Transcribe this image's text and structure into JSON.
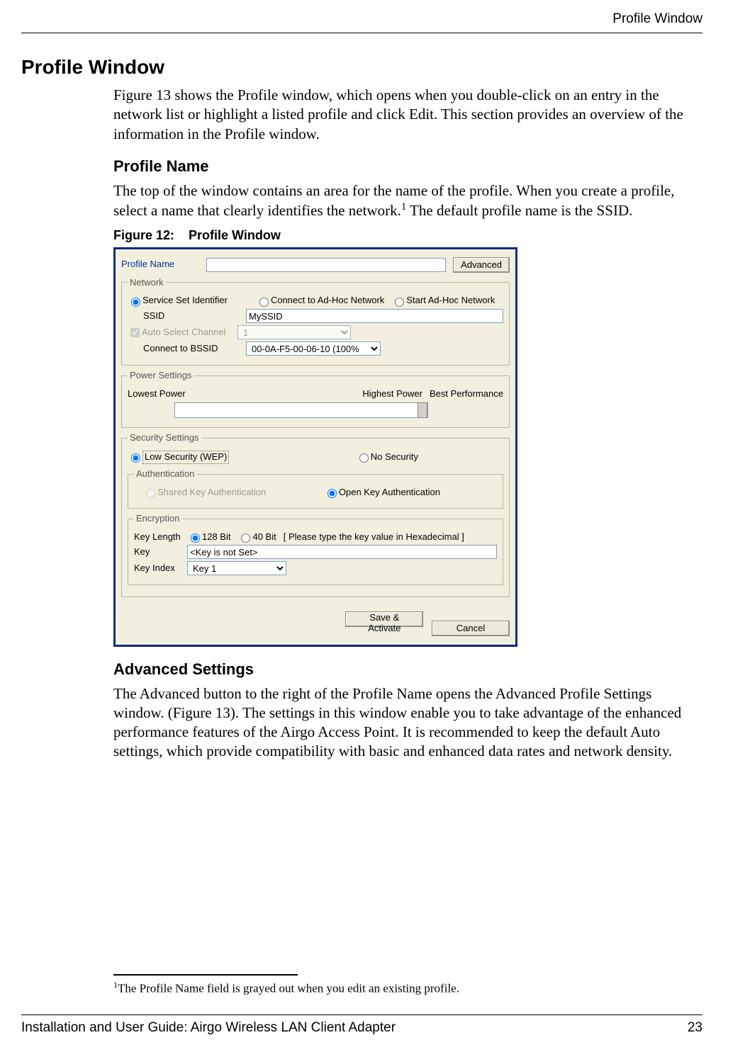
{
  "running_head": "Profile Window",
  "h1": "Profile Window",
  "intro": "Figure 13 shows the Profile window, which opens when you double-click on an entry in the network list or highlight a listed profile and click Edit. This section provides an overview of the information in the Profile window.",
  "profile_name_h": "Profile Name",
  "profile_name_p_a": "The top of the window contains an area for the name of the profile. When you create a profile, select a name that clearly identifies the network.",
  "profile_name_p_b": " The default profile name is the SSID.",
  "sup1": "1",
  "fig_caption_a": "Figure 12:",
  "fig_caption_b": "Profile Window",
  "adv_h": "Advanced Settings",
  "adv_p": "The Advanced button to the right of the Profile Name opens the Advanced Profile Settings window. (Figure 13). The settings in this window enable you to take advantage of the enhanced performance features of the Airgo Access Point. It is recommended to keep the default Auto settings, which provide compatibility with basic and enhanced data rates and network density.",
  "footnote_sup": "1",
  "footnote_text": "The Profile Name field is grayed out when you edit an existing profile.",
  "footer_left": "Installation and User Guide: Airgo Wireless LAN Client Adapter",
  "footer_right": "23",
  "shot": {
    "profile_name_lbl": "Profile Name",
    "profile_name_val": "",
    "advanced_btn": "Advanced",
    "network_legend": "Network",
    "ssi_radio": "Service Set Identifier",
    "adhoc_connect": "Connect to Ad-Hoc Network",
    "adhoc_start": "Start Ad-Hoc Network",
    "ssid_lbl": "SSID",
    "ssid_val": "MySSID",
    "autoch_lbl": "Auto Select Channel",
    "autoch_val": "1",
    "bssid_lbl": "Connect to BSSID",
    "bssid_val": "00-0A-F5-00-06-10 (100%",
    "power_legend": "Power Settings",
    "power_low": "Lowest Power",
    "power_high": "Highest Power",
    "power_best": "Best Performance",
    "sec_legend": "Security Settings",
    "sec_low": "Low Security (WEP)",
    "sec_none": "No Security",
    "auth_legend": "Authentication",
    "auth_shared": "Shared Key Authentication",
    "auth_open": "Open Key Authentication",
    "enc_legend": "Encryption",
    "keylen_lbl": "Key Length",
    "kl128": "128 Bit",
    "kl40": "40 Bit",
    "hex_hint": "[ Please type the key value in Hexadecimal ]",
    "key_lbl": "Key",
    "key_val": "<Key is not Set>",
    "keyidx_lbl": "Key Index",
    "keyidx_val": "Key 1",
    "save_btn": "Save & Activate",
    "cancel_btn": "Cancel"
  }
}
